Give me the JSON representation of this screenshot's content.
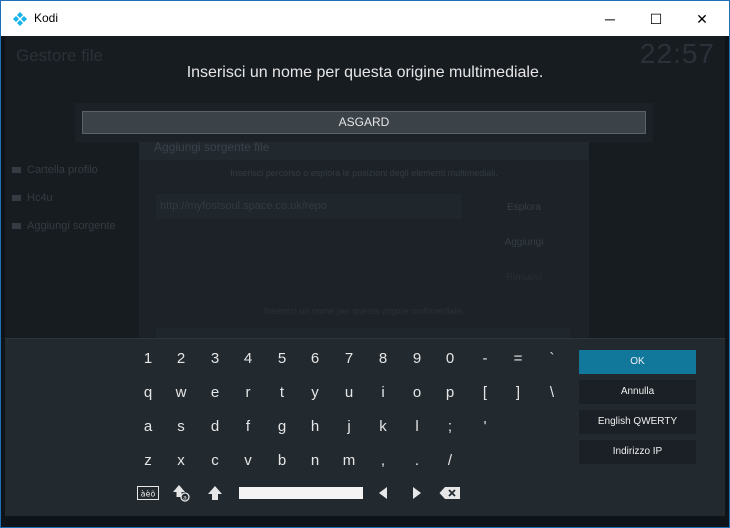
{
  "window": {
    "title": "Kodi",
    "minimize_glyph": "─",
    "maximize_glyph": "☐",
    "close_glyph": "✕"
  },
  "background": {
    "page_title": "Gestore file",
    "clock": "22:57",
    "side_items": [
      "Cartella profilo",
      "Hc4u",
      "Aggiungi sorgente"
    ],
    "dialog_title": "Aggiungi sorgente file",
    "dialog_subtitle": "Inserisci percorso o esplora le posizioni degli elementi multimediali.",
    "url_value": "http://myfostsoul.space.co.uk/repo",
    "browse_label": "Esplora",
    "add_label": "Aggiungi",
    "remove_label": "Rimuovi",
    "name_label": "Inserisci un nome per questa origine multimediale."
  },
  "prompt": {
    "heading": "Inserisci un nome per questa origine multimediale.",
    "value": "ASGARD"
  },
  "keyboard": {
    "row1": [
      "1",
      "2",
      "3",
      "4",
      "5",
      "6",
      "7",
      "8",
      "9",
      "0",
      "-",
      "=",
      "`"
    ],
    "row2": [
      "q",
      "w",
      "e",
      "r",
      "t",
      "y",
      "u",
      "i",
      "o",
      "p",
      "[",
      "]",
      "\\"
    ],
    "row3": [
      "a",
      "s",
      "d",
      "f",
      "g",
      "h",
      "j",
      "k",
      "l",
      ";",
      "'"
    ],
    "row4": [
      "z",
      "x",
      "c",
      "v",
      "b",
      "n",
      "m",
      ",",
      ".",
      "/"
    ],
    "icons": {
      "symbols": "symbols-icon",
      "shift_lock": "shift-lock-icon",
      "shift": "shift-icon",
      "left": "arrow-left-icon",
      "right": "arrow-right-icon",
      "backspace": "backspace-icon"
    },
    "symbols_label": "àèö"
  },
  "buttons": {
    "ok": "OK",
    "cancel": "Annulla",
    "layout": "English QWERTY",
    "ip": "Indirizzo IP"
  },
  "colors": {
    "focus": "#12789b",
    "kodi_blue": "#1f6fb8",
    "panel": "#222a30"
  }
}
